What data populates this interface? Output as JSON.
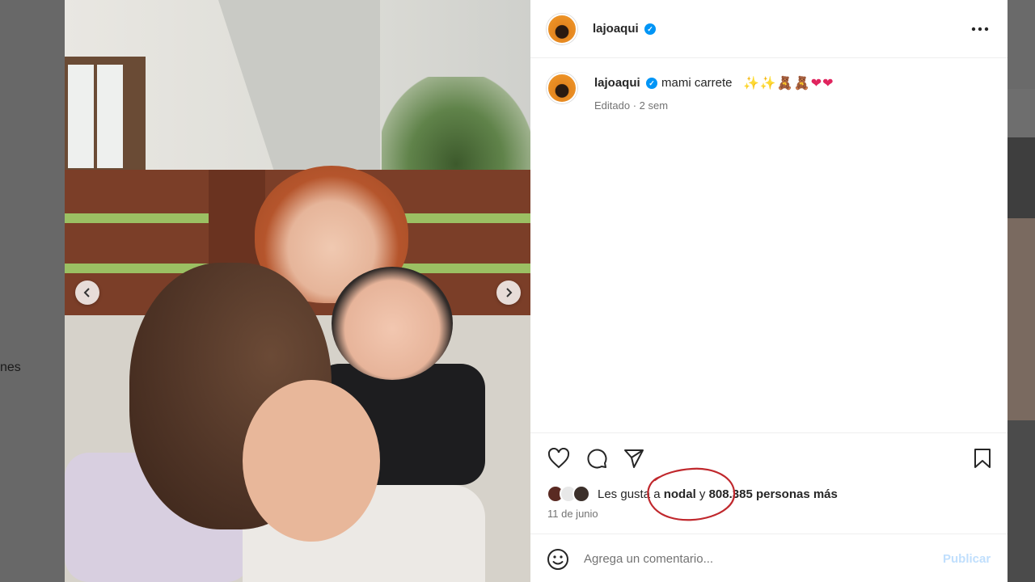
{
  "background": {
    "left_partial_text": "nes"
  },
  "post": {
    "username": "lajoaqui",
    "more_icon": "more-horizontal-icon",
    "caption": {
      "username": "lajoaqui",
      "text": "mami carrete",
      "emojis": [
        "sparkles",
        "sparkles",
        "teddy-bear",
        "teddy-bear",
        "red-heart",
        "red-heart"
      ],
      "meta": "Editado · 2 sem"
    },
    "actions": [
      "heart-icon",
      "comment-icon",
      "share-icon",
      "bookmark-icon"
    ],
    "likes": {
      "prefix": "Les gusta a ",
      "liker": "nodal",
      "middle": " y ",
      "count": "808.385 personas más"
    },
    "date": "11 de junio",
    "comment": {
      "placeholder": "Agrega un comentario...",
      "publish_label": "Publicar"
    }
  },
  "colors": {
    "verified": "#0095f6",
    "publish_disabled": "#c0dffd",
    "annotation_circle": "#c0282d"
  }
}
